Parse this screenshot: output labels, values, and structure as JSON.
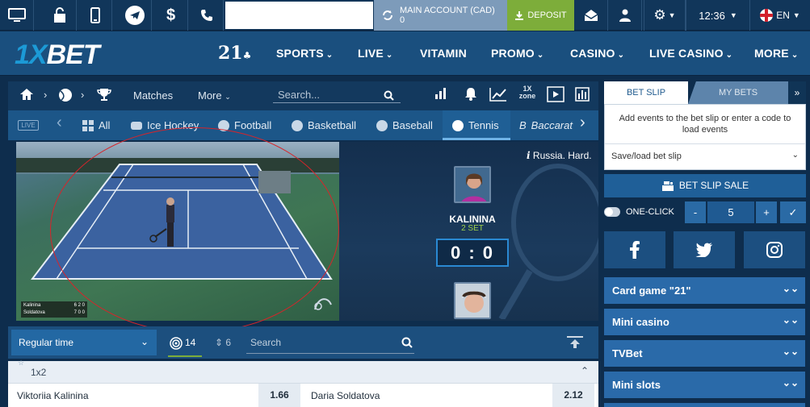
{
  "topbar": {
    "account_label": "MAIN ACCOUNT (CAD)",
    "balance": "0",
    "deposit_label": "DEPOSIT",
    "time": "12:36",
    "language": "EN",
    "icons": [
      "desktop-icon",
      "lock-icon",
      "mobile-icon",
      "telegram-icon",
      "dollar-icon",
      "phone-icon",
      "refresh-icon",
      "download-icon",
      "mail-icon",
      "user-icon",
      "gear-icon",
      "chevron-down-icon"
    ]
  },
  "brand": {
    "logo": "1XBET",
    "link_21": "21"
  },
  "nav": {
    "items": [
      {
        "label": "SPORTS",
        "chevron": true
      },
      {
        "label": "LIVE",
        "chevron": true
      },
      {
        "label": "VITAMIN",
        "chevron": false
      },
      {
        "label": "PROMO",
        "chevron": true
      },
      {
        "label": "CASINO",
        "chevron": true
      },
      {
        "label": "LIVE CASINO",
        "chevron": true
      },
      {
        "label": "MORE",
        "chevron": true
      }
    ]
  },
  "subnav": {
    "matches": "Matches",
    "more": "More",
    "search_placeholder": "Search...",
    "zone_label": "1X zone"
  },
  "sport_tabs": {
    "live_badge": "LIVE",
    "items": [
      "All",
      "Ice Hockey",
      "Football",
      "Basketball",
      "Baseball",
      "Tennis",
      "Baccarat"
    ],
    "active": "Tennis"
  },
  "match": {
    "info": "Russia. Hard.",
    "player_top": "KALININA",
    "set": "2 SET",
    "score": "0 : 0",
    "scorebug": [
      {
        "name": "Kalinina",
        "s1": "6",
        "s2": "2",
        "s3": "0"
      },
      {
        "name": "Soldatova",
        "s1": "7",
        "s2": "0",
        "s3": "0"
      }
    ]
  },
  "filter": {
    "period": "Regular time",
    "count_markets": "14",
    "count_other": "6",
    "search_placeholder": "Search"
  },
  "market": {
    "label": "1x2",
    "odds": [
      {
        "name": "Viktoriia Kalinina",
        "value": "1.66"
      },
      {
        "name": "Daria Soldatova",
        "value": "2.12"
      }
    ]
  },
  "betslip": {
    "tab_slip": "BET SLIP",
    "tab_mybets": "MY BETS",
    "hint": "Add events to the bet slip or enter a code to load events",
    "save_load": "Save/load bet slip",
    "sale": "BET SLIP SALE",
    "one_click": "ONE-CLICK",
    "stake": "5"
  },
  "sidebar": {
    "items": [
      "Card game \"21\"",
      "Mini casino",
      "TVBet",
      "Mini slots"
    ]
  },
  "colors": {
    "topbar": "#11365a",
    "nav": "#1a4f7e",
    "deposit": "#7dad3a",
    "account": "#7d9bba",
    "accent": "#2a6aa9"
  }
}
